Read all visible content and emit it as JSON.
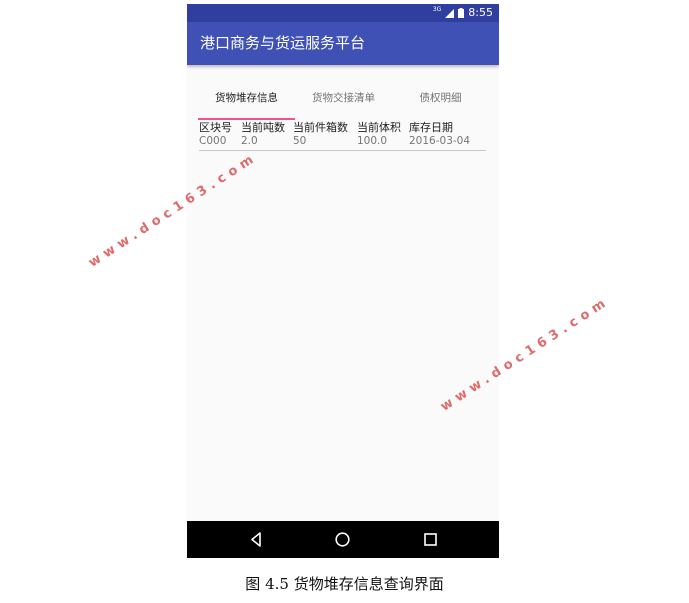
{
  "status_bar": {
    "network": "3G",
    "time": "8:55"
  },
  "app_bar": {
    "title": "港口商务与货运服务平台"
  },
  "tabs": [
    {
      "label": "货物堆存信息",
      "active": true
    },
    {
      "label": "货物交接清单",
      "active": false
    },
    {
      "label": "债权明细",
      "active": false
    }
  ],
  "table": {
    "headers": [
      "区块号",
      "当前吨数",
      "当前件箱数",
      "当前体积",
      "库存日期"
    ],
    "rows": [
      [
        "C000",
        "2.0",
        "50",
        "100.0",
        "2016-03-04"
      ]
    ]
  },
  "nav_bar": {
    "icons": [
      "back-icon",
      "home-icon",
      "recents-icon"
    ]
  },
  "watermarks": [
    "www.doc163.com",
    "www.doc163.com"
  ],
  "caption": "图 4.5 货物堆存信息查询界面",
  "colors": {
    "status_bar": "#303f9f",
    "app_bar": "#3f51b5",
    "tab_indicator": "#e91e63",
    "watermark": "#e06b6b"
  }
}
